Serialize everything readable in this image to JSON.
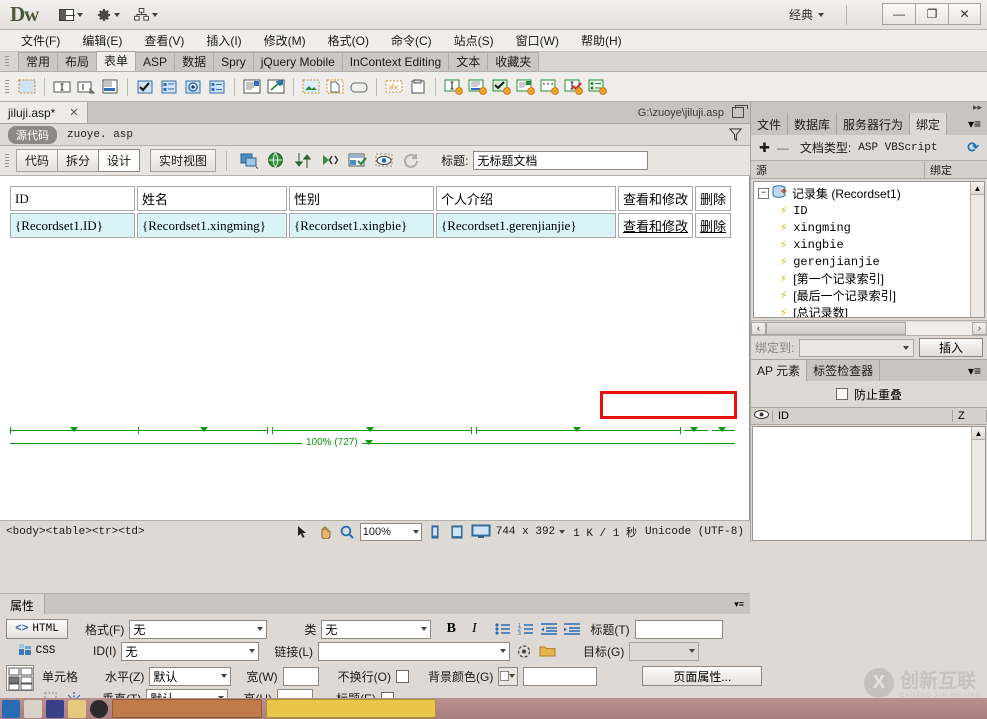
{
  "titlebar": {
    "logo": "Dw",
    "workspace": "经典",
    "buttons": [
      {
        "name": "layout-switcher",
        "icon": "layout-icon"
      },
      {
        "name": "settings",
        "icon": "gear-icon"
      },
      {
        "name": "site-manager",
        "icon": "site-icon"
      }
    ],
    "window_controls": {
      "minimize": "—",
      "maximize": "❐",
      "close": "✕"
    }
  },
  "menubar": {
    "items": [
      "文件(F)",
      "编辑(E)",
      "查看(V)",
      "插入(I)",
      "修改(M)",
      "格式(O)",
      "命令(C)",
      "站点(S)",
      "窗口(W)",
      "帮助(H)"
    ]
  },
  "insert_tabs": {
    "items": [
      "常用",
      "布局",
      "表单",
      "ASP",
      "数据",
      "Spry",
      "jQuery Mobile",
      "InContext Editing",
      "文本",
      "收藏夹"
    ],
    "active": "表单"
  },
  "insert_toolbar": {
    "icons": [
      "form-icon",
      "text-field-icon",
      "textarea-icon",
      "hidden-field-icon",
      "checkbox-icon",
      "checkbox-group-icon",
      "radio-button-icon",
      "radio-group-icon",
      "select-list-icon",
      "jump-menu-icon",
      "image-field-icon",
      "file-field-icon",
      "button-icon",
      "label-icon",
      "fieldset-icon",
      "spry-text-field-icon",
      "spry-textarea-icon",
      "spry-checkbox-icon",
      "spry-select-icon",
      "spry-password-icon",
      "spry-confirm-icon",
      "spry-radio-group-icon"
    ]
  },
  "document": {
    "tab_label": "jiluji.asp*",
    "tab_close": "✕",
    "file_path": "G:\\zuoye\\jiluji.asp",
    "source_pill": "源代码",
    "source_file": "zuoye. asp"
  },
  "viewbar": {
    "view_buttons": [
      "代码",
      "拆分",
      "设计",
      "实时视图"
    ],
    "active_view": "设计",
    "icons": [
      "live-code-icon",
      "preview-browser-icon",
      "file-transfer-icon",
      "code-navigator-icon",
      "validate-icon",
      "visual-aids-icon",
      "refresh-icon"
    ],
    "title_label": "标题:",
    "title_value": "无标题文档"
  },
  "canvas": {
    "table": {
      "headers": [
        "ID",
        "姓名",
        "性别",
        "个人介绍",
        "查看和修改",
        "删除"
      ],
      "data_row": [
        "{Recordset1.ID}",
        "{Recordset1.xingming}",
        "{Recordset1.xingbie}",
        "{Recordset1.gerenjianjie}",
        "查看和修改",
        "删除"
      ]
    },
    "ruler_label": "100% (727)",
    "highlight_color": "#e8110f"
  },
  "statusbar": {
    "tag_selector": "<body><table><tr><td>",
    "tools": [
      "select-tool-icon",
      "hand-tool-icon",
      "zoom-tool-icon"
    ],
    "zoom": "100%",
    "device_icons": [
      "mobile-size-icon",
      "tablet-size-icon",
      "desktop-size-icon"
    ],
    "window_size": "744 x 392",
    "download_size": "1 K / 1 秒",
    "encoding": "Unicode (UTF-8)"
  },
  "right_panel": {
    "tabs": [
      "文件",
      "数据库",
      "服务器行为",
      "绑定"
    ],
    "active_tab": "绑定",
    "toolbar": {
      "add": "✚",
      "remove": "—",
      "doctype_label": "文档类型:",
      "doctype_value": "ASP VBScript",
      "refresh": "⟳"
    },
    "list_headers": [
      "源",
      "绑定"
    ],
    "tree": {
      "root": "记录集 (Recordset1)",
      "expander": "−",
      "fields": [
        "ID",
        "xingming",
        "xingbie",
        "gerenjianjie",
        "[第一个记录索引]",
        "[最后一个记录索引]",
        "[总记录数]"
      ]
    },
    "bind_to_label": "绑定到:",
    "insert_button": "插入",
    "scroll": {
      "left": "‹",
      "right": "›"
    }
  },
  "ap_panel": {
    "tabs": [
      "AP 元素",
      "标签检查器"
    ],
    "active_tab": "AP 元素",
    "prevent_overlap_label": "防止重叠",
    "columns": [
      "eye-icon",
      "ID",
      "Z"
    ]
  },
  "properties": {
    "panel_tab": "属性",
    "mode_html": "HTML",
    "mode_css": "CSS",
    "format_label": "格式(F)",
    "format_value": "无",
    "id_label": "ID(I)",
    "id_value": "无",
    "class_label": "类",
    "class_value": "无",
    "link_label": "链接(L)",
    "link_value": "",
    "bold": "B",
    "italic": "I",
    "list_icons": [
      "unordered-list-icon",
      "ordered-list-icon",
      "outdent-icon",
      "indent-icon"
    ],
    "title_label": "标题(T)",
    "title_value": "",
    "target_label": "目标(G)",
    "target_value": "",
    "cell_label": "单元格",
    "horz_label": "水平(Z)",
    "horz_value": "默认",
    "vert_label": "垂直(T)",
    "vert_value": "默认",
    "width_label": "宽(W)",
    "width_value": "",
    "height_label": "高(H)",
    "height_value": "",
    "nowrap_label": "不换行(O)",
    "header_label": "标题(E)",
    "bgcolor_label": "背景颜色(G)",
    "bgcolor_value": "",
    "page_properties_button": "页面属性..."
  },
  "watermark": {
    "mark": "X",
    "text": "创新互联",
    "subtext": "CHUANG XIN HU LIAN"
  }
}
